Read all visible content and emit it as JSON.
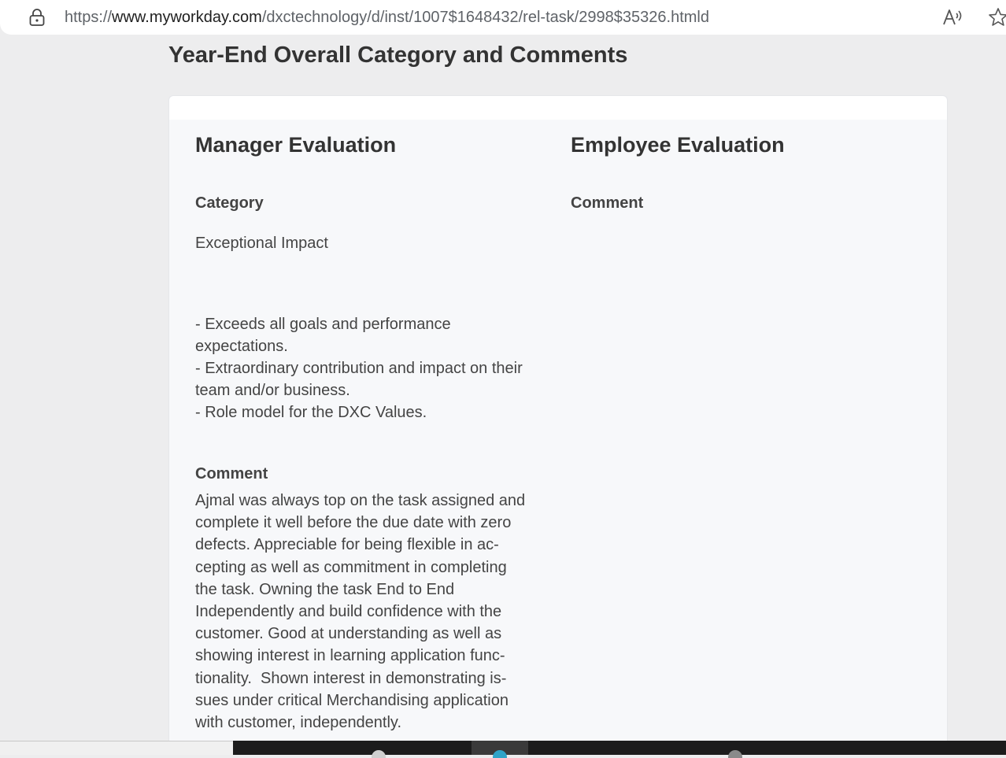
{
  "browser": {
    "url_prefix": "https://",
    "url_host": "www.myworkday.com",
    "url_path": "/dxctechnology/d/inst/1007$1648432/rel-task/2998$35326.htmld",
    "icons": {
      "lock": "lock-icon",
      "read_aloud": "read-aloud-icon",
      "favorite": "star-icon"
    }
  },
  "page": {
    "section_title": "Year-End Overall Category and Comments"
  },
  "manager": {
    "title": "Manager Evaluation",
    "category_label": "Category",
    "category_value": "Exceptional Impact",
    "category_description": [
      "- Exceeds all goals and performance",
      "expectations.",
      "- Extraordinary contribution and impact on their",
      "team and/or business.",
      "- Role model for the DXC Values."
    ],
    "comment_label": "Comment",
    "comment_lines": [
      "Ajmal was always top on the task assigned and",
      "complete it well before the due date with zero",
      "defects. Appreciable for being flexible in ac-",
      "cepting as well as commitment in completing",
      "the task. Owning the task End to End",
      "Independently and build confidence with the",
      "customer. Good at understanding as well as",
      "showing interest in learning application func-",
      "tionality.  Shown interest in demonstrating is-",
      "sues under critical Merchandising application",
      "with customer, independently."
    ]
  },
  "employee": {
    "title": "Employee Evaluation",
    "comment_label": "Comment"
  },
  "colors": {
    "page_background": "#ededee",
    "card_background": "#f7f8fa",
    "heading_text": "#333333",
    "body_text": "#444444",
    "url_text": "#5f6368"
  }
}
